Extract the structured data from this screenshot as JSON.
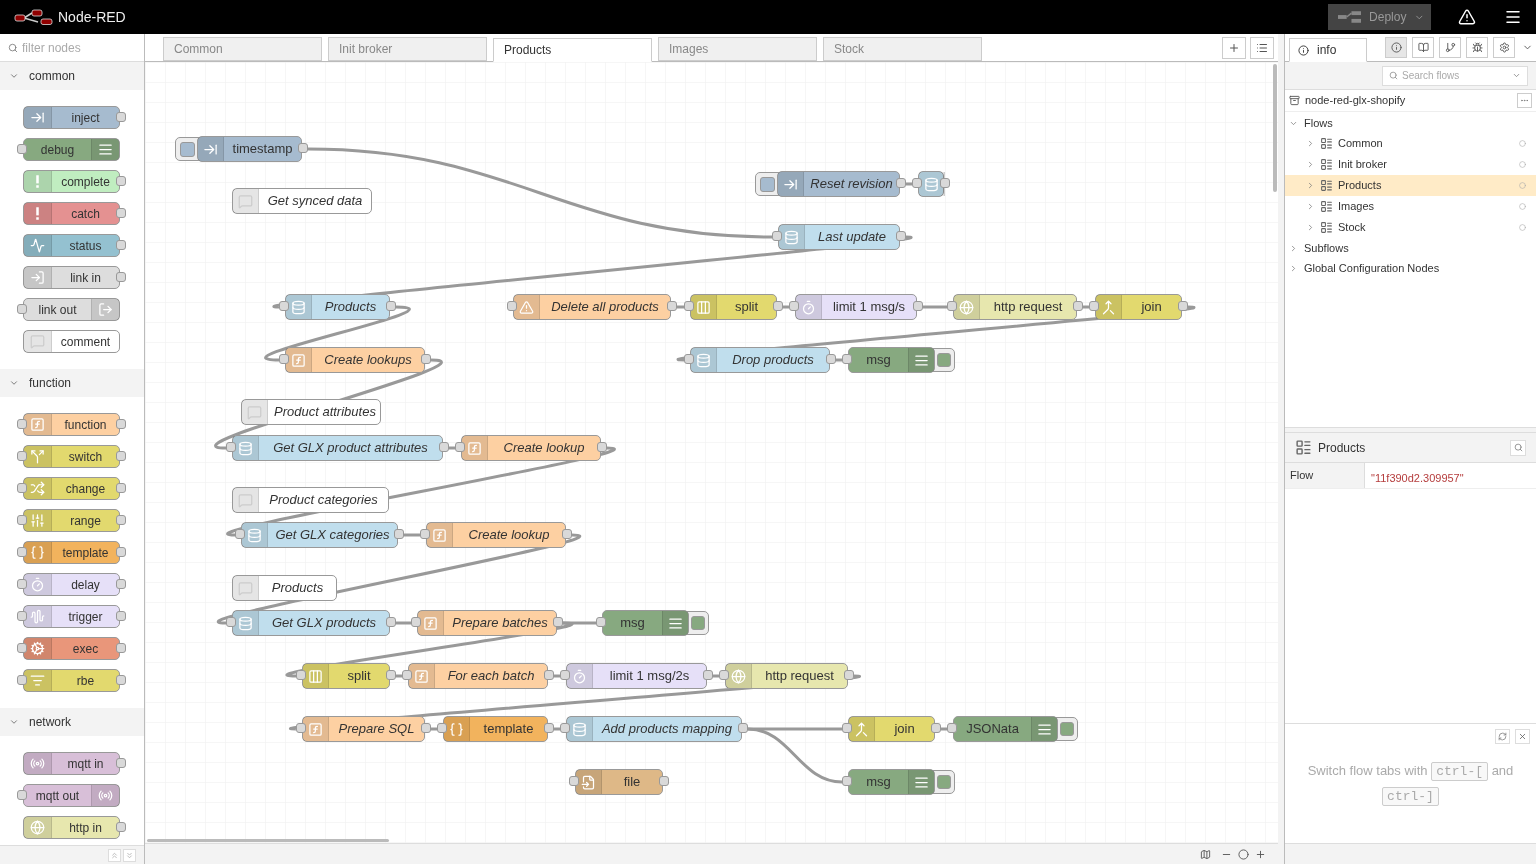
{
  "header": {
    "title": "Node-RED",
    "deploy": "Deploy"
  },
  "palette": {
    "filter_placeholder": "filter nodes",
    "categories": [
      {
        "name": "common",
        "expanded": true,
        "nodes": [
          {
            "label": "inject",
            "kind": "inject",
            "color": "#a6bbcf"
          },
          {
            "label": "debug",
            "kind": "debug",
            "color": "#87a980"
          },
          {
            "label": "complete",
            "kind": "complete",
            "color": "#c0edc0"
          },
          {
            "label": "catch",
            "kind": "catch",
            "color": "#e49191"
          },
          {
            "label": "status",
            "kind": "status",
            "color": "#94c1d0"
          },
          {
            "label": "link in",
            "kind": "link-in",
            "color": "#dddddd"
          },
          {
            "label": "link out",
            "kind": "link-out",
            "color": "#dddddd"
          },
          {
            "label": "comment",
            "kind": "comment",
            "color": "#ffffff"
          }
        ]
      },
      {
        "name": "function",
        "expanded": true,
        "nodes": [
          {
            "label": "function",
            "kind": "function",
            "color": "#fdd0a2"
          },
          {
            "label": "switch",
            "kind": "switch",
            "color": "#e2d96e"
          },
          {
            "label": "change",
            "kind": "change",
            "color": "#e2d96e"
          },
          {
            "label": "range",
            "kind": "range",
            "color": "#e2d96e"
          },
          {
            "label": "template",
            "kind": "template",
            "color": "#f2b35d"
          },
          {
            "label": "delay",
            "kind": "delay",
            "color": "#e6e0f8"
          },
          {
            "label": "trigger",
            "kind": "trigger",
            "color": "#e6e0f8"
          },
          {
            "label": "exec",
            "kind": "exec",
            "color": "#e9967a"
          },
          {
            "label": "rbe",
            "kind": "rbe",
            "color": "#e2d96e"
          }
        ]
      },
      {
        "name": "network",
        "expanded": true,
        "nodes": [
          {
            "label": "mqtt in",
            "kind": "mqtt-in",
            "color": "#d8bfd8"
          },
          {
            "label": "mqtt out",
            "kind": "mqtt-out",
            "color": "#d8bfd8"
          },
          {
            "label": "http in",
            "kind": "http-in",
            "color": "#e7e7ae"
          }
        ]
      }
    ]
  },
  "workspace": {
    "tabs": [
      {
        "label": "Common",
        "selected": false
      },
      {
        "label": "Init broker",
        "selected": false
      },
      {
        "label": "Products",
        "selected": true
      },
      {
        "label": "Images",
        "selected": false
      },
      {
        "label": "Stock",
        "selected": false
      }
    ],
    "nodes": [
      {
        "label": "timestamp",
        "kind": "inject",
        "color": "#a6bbcf",
        "named": false
      },
      {
        "label": "Get synced data",
        "kind": "comment",
        "color": "#ffffff",
        "named": true
      },
      {
        "label": "Reset revision",
        "kind": "inject",
        "color": "#a6bbcf",
        "named": true
      },
      {
        "kind": "db",
        "color": "#c0deed"
      },
      {
        "label": "Last update",
        "kind": "db",
        "color": "#c0deed",
        "named": true
      },
      {
        "label": "Products",
        "kind": "db",
        "color": "#c0deed",
        "named": true
      },
      {
        "label": "Delete all products",
        "kind": "warning",
        "color": "#fdd0a2",
        "named": true
      },
      {
        "label": "split",
        "kind": "split",
        "color": "#e2d96e",
        "named": false
      },
      {
        "label": "limit 1 msg/s",
        "kind": "delay",
        "color": "#e6e0f8",
        "named": false
      },
      {
        "label": "http request",
        "kind": "http-request",
        "color": "#e7e7ae",
        "named": false
      },
      {
        "label": "join",
        "kind": "join",
        "color": "#e2d96e",
        "named": false
      },
      {
        "label": "Create lookups",
        "kind": "function",
        "color": "#fdd0a2",
        "named": true
      },
      {
        "label": "Drop products",
        "kind": "db",
        "color": "#c0deed",
        "named": true
      },
      {
        "label": "msg",
        "kind": "debug",
        "color": "#87a980",
        "named": false,
        "active": true
      },
      {
        "label": "Product attributes",
        "kind": "comment",
        "color": "#ffffff",
        "named": true
      },
      {
        "label": "Get GLX product attributes",
        "kind": "db",
        "color": "#c0deed",
        "named": true
      },
      {
        "label": "Create lookup",
        "kind": "function",
        "color": "#fdd0a2",
        "named": true
      },
      {
        "label": "Product categories",
        "kind": "comment",
        "color": "#ffffff",
        "named": true
      },
      {
        "label": "Get GLX categories",
        "kind": "db",
        "color": "#c0deed",
        "named": true
      },
      {
        "label": "Create lookup",
        "kind": "function",
        "color": "#fdd0a2",
        "named": true
      },
      {
        "label": "Products",
        "kind": "comment",
        "color": "#ffffff",
        "named": true
      },
      {
        "label": "Get GLX products",
        "kind": "db",
        "color": "#c0deed",
        "named": true
      },
      {
        "label": "Prepare batches",
        "kind": "function",
        "color": "#fdd0a2",
        "named": true
      },
      {
        "label": "msg",
        "kind": "debug",
        "color": "#87a980",
        "named": false,
        "active": true
      },
      {
        "label": "split",
        "kind": "split",
        "color": "#e2d96e",
        "named": false
      },
      {
        "label": "For each batch",
        "kind": "function",
        "color": "#fdd0a2",
        "named": true
      },
      {
        "label": "limit 1 msg/2s",
        "kind": "delay",
        "color": "#e6e0f8",
        "named": false
      },
      {
        "label": "http request",
        "kind": "http-request",
        "color": "#e7e7ae",
        "named": false
      },
      {
        "label": "Prepare SQL",
        "kind": "function",
        "color": "#fdd0a2",
        "named": true
      },
      {
        "label": "template",
        "kind": "template",
        "color": "#f2b35d",
        "named": false
      },
      {
        "label": "Add products mapping",
        "kind": "db",
        "color": "#c0deed",
        "named": true
      },
      {
        "label": "join",
        "kind": "join",
        "color": "#e2d96e",
        "named": false
      },
      {
        "label": "JSONata",
        "kind": "debug",
        "color": "#87a980",
        "named": false,
        "active": true
      },
      {
        "label": "msg",
        "kind": "debug",
        "color": "#87a980",
        "named": false,
        "active": true
      },
      {
        "label": "file",
        "kind": "file",
        "color": "#deb887",
        "named": false
      }
    ]
  },
  "sidebar": {
    "tab": "info",
    "search_placeholder": "Search flows",
    "project": "node-red-glx-shopify",
    "tree": [
      {
        "label": "Flows",
        "expanded": true,
        "children": [
          {
            "label": "Common",
            "selected": false,
            "expanded": false
          },
          {
            "label": "Init broker",
            "selected": false,
            "expanded": false
          },
          {
            "label": "Products",
            "selected": true,
            "expanded": false
          },
          {
            "label": "Images",
            "selected": false,
            "expanded": false
          },
          {
            "label": "Stock",
            "selected": false,
            "expanded": false
          }
        ]
      },
      {
        "label": "Subflows",
        "expanded": false
      },
      {
        "label": "Global Configuration Nodes",
        "expanded": false
      }
    ],
    "details": {
      "title": "Products",
      "rows": [
        {
          "key": "Flow",
          "value": "\"11f390d2.309957\""
        }
      ]
    },
    "tip": {
      "before": "Switch flow tabs with",
      "key_1": "ctrl-[",
      "middle": "and",
      "key_2": "ctrl-]"
    }
  }
}
